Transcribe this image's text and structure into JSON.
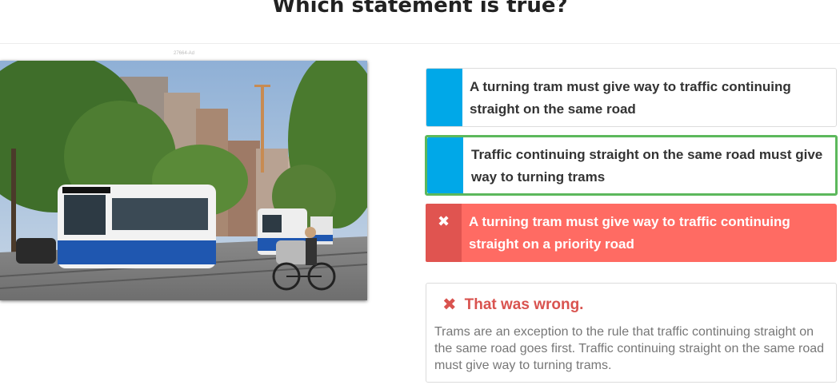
{
  "question": {
    "title": "Which statement is true?"
  },
  "image": {
    "caption": "27664-Ad"
  },
  "answers": [
    {
      "text": "A turning tram must give way to traffic continuing straight on the same road",
      "state": "neutral"
    },
    {
      "text": "Traffic continuing straight on the same road must give way to turning trams",
      "state": "correct"
    },
    {
      "text": "A turning tram must give way to traffic continuing straight on a priority road",
      "state": "wrong-selected",
      "icon": "x-icon"
    }
  ],
  "feedback": {
    "icon": "x-icon",
    "heading": "That was wrong.",
    "body": "Trams are an exception to the rule that traffic continuing straight on the same road goes first. Traffic continuing straight on the same road must give way to turning trams."
  },
  "colors": {
    "marker": "#00a8e8",
    "correct_border": "#5cb85c",
    "wrong_bg": "#ff6b63",
    "wrong_marker": "#e05450",
    "wrong_text": "#d9534f"
  }
}
